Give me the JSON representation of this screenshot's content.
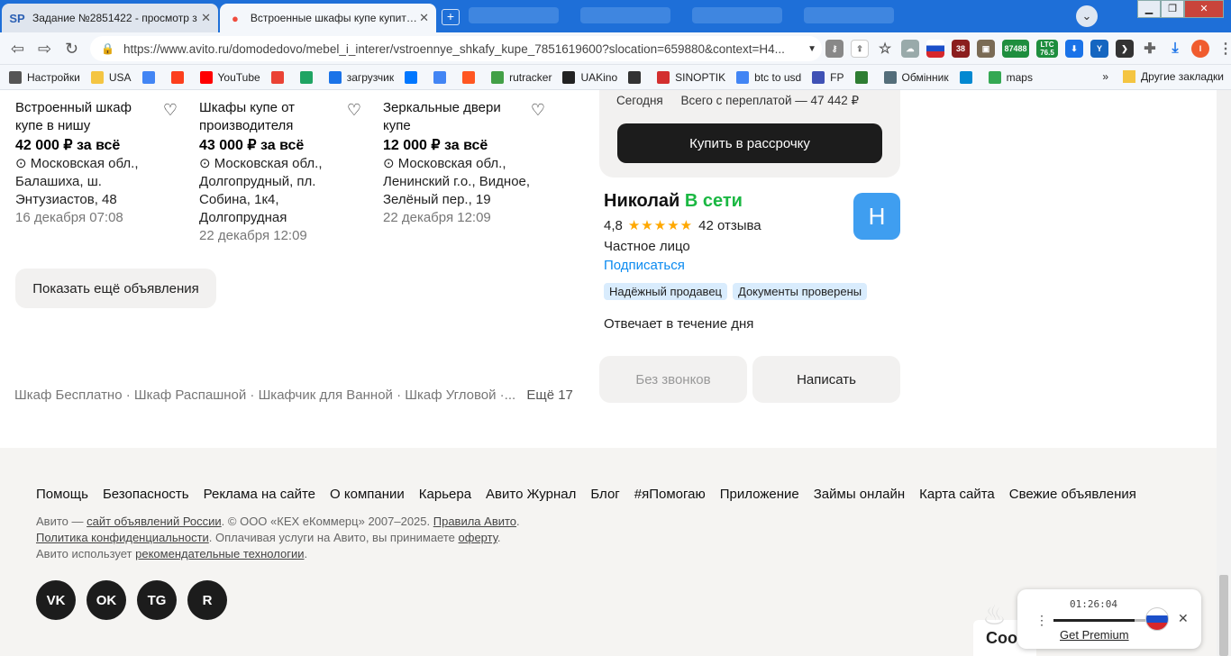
{
  "browser": {
    "tabs": [
      {
        "title": "Задание №2851422 - просмотр з",
        "favicon": "SP",
        "close": "✕"
      },
      {
        "title": "Встроенные шкафы купе купить в",
        "favicon": "●",
        "close": "✕"
      }
    ],
    "new_tab": "+",
    "url": "https://www.avito.ru/domodedovo/mebel_i_interer/vstroennye_shkafy_kupe_7851619600?slocation=659880&context=H4...",
    "ext_badges": {
      "b1": "38",
      "b2": "87488",
      "ltc_label": "LTC",
      "ltc_value": "76.5"
    },
    "profile_initial": "I",
    "bookmarks": [
      {
        "label": "Настройки",
        "icon": "gear-icon",
        "color": "#555555"
      },
      {
        "label": "USA",
        "icon": "folder-icon",
        "color": "#f4c542"
      },
      {
        "label": "",
        "icon": "google-icon",
        "color": "#4285f4"
      },
      {
        "label": "",
        "icon": "yandex-icon",
        "color": "#fc3f1d"
      },
      {
        "label": "YouTube",
        "icon": "youtube-icon",
        "color": "#ff0000"
      },
      {
        "label": "",
        "icon": "gmail-icon",
        "color": "#ea4335"
      },
      {
        "label": "",
        "icon": "drive-icon",
        "color": "#1fa463"
      },
      {
        "label": "загрузчик",
        "icon": "infinity-icon",
        "color": "#1a73e8"
      },
      {
        "label": "",
        "icon": "vk-icon",
        "color": "#0077ff"
      },
      {
        "label": "",
        "icon": "translate-icon",
        "color": "#4285f4"
      },
      {
        "label": "",
        "icon": "f-icon",
        "color": "#ff5722"
      },
      {
        "label": "rutracker",
        "icon": "rutracker-icon",
        "color": "#43a047"
      },
      {
        "label": "UAKino",
        "icon": "film-icon",
        "color": "#222222"
      },
      {
        "label": "",
        "icon": "chess-icon",
        "color": "#333333"
      },
      {
        "label": "SINOPTIK",
        "icon": "thermometer-icon",
        "color": "#d32f2f"
      },
      {
        "label": "btc to usd",
        "icon": "google-icon",
        "color": "#4285f4"
      },
      {
        "label": "FP",
        "icon": "fp-icon",
        "color": "#3f51b5"
      },
      {
        "label": "",
        "icon": "bc-icon",
        "color": "#2e7d32"
      },
      {
        "label": "Обмінник",
        "icon": "diamond-icon",
        "color": "#546e7a"
      },
      {
        "label": "",
        "icon": "snowflake-icon",
        "color": "#0288d1"
      },
      {
        "label": "maps",
        "icon": "maps-icon",
        "color": "#34a853"
      }
    ],
    "bookmarks_more": "»",
    "other_bookmarks": "Другие закладки"
  },
  "listings": [
    {
      "title": "Встроенный шкаф купе в нишу",
      "price": "42 000 ₽ за всё",
      "address": "Московская обл., Балашиха, ш. Энтузиастов, 48",
      "date": "16 декабря 07:08"
    },
    {
      "title": "Шкафы купе от производителя",
      "price": "43 000 ₽ за всё",
      "address": "Московская обл., Долгопрудный, пл. Собина, 1к4, Долгопрудная",
      "date": "22 декабря 12:09"
    },
    {
      "title": "Зеркальные двери купе",
      "price": "12 000 ₽ за всё",
      "address": "Московская обл., Ленинский г.о., Видное, Зелёный пер., 19",
      "date": "22 декабря 12:09"
    }
  ],
  "show_more": "Показать ещё объявления",
  "tags": {
    "text": "Шкаф Бесплатно · Шкаф Распашной · Шкафчик для Ванной · Шкаф Угловой ·...",
    "more": "Ещё 17"
  },
  "credit": {
    "today": "Сегодня",
    "overpay": "Всего с переплатой — 47 442 ₽",
    "buy": "Купить в рассрочку"
  },
  "seller": {
    "name": "Николай",
    "online": "В сети",
    "avatar": "Н",
    "rating": "4,8",
    "stars": "★★★★★",
    "reviews": "42 отзыва",
    "kind": "Частное лицо",
    "subscribe": "Подписаться",
    "badges": [
      "Надёжный продавец",
      "Документы проверены"
    ],
    "replies": "Отвечает в течение дня"
  },
  "actions": {
    "no_calls": "Без звонков",
    "write": "Написать"
  },
  "footer": {
    "nav": [
      "Помощь",
      "Безопасность",
      "Реклама на сайте",
      "О компании",
      "Карьера",
      "Авито Журнал",
      "Блог",
      "#яПомогаю",
      "Приложение",
      "Займы онлайн",
      "Карта сайта",
      "Свежие объявления"
    ],
    "legal1_a": "Авито — ",
    "legal1_link": "сайт объявлений России",
    "legal1_b": ". © ООО «КЕХ еКоммерц» 2007–2025. ",
    "legal1_link2": "Правила Авито",
    "legal2_link": "Политика конфиденциальности",
    "legal2_b": ". Оплачивая услуги на Авито, вы принимаете ",
    "legal2_link2": "оферту",
    "legal3_a": "Авито использует ",
    "legal3_link": "рекомендательные технологии",
    "social": [
      "VK",
      "OK",
      "TG",
      "R"
    ]
  },
  "cookie_peek": "Coo",
  "player": {
    "time": "01:26:04",
    "premium": "Get Premium",
    "progress": 0.88
  }
}
